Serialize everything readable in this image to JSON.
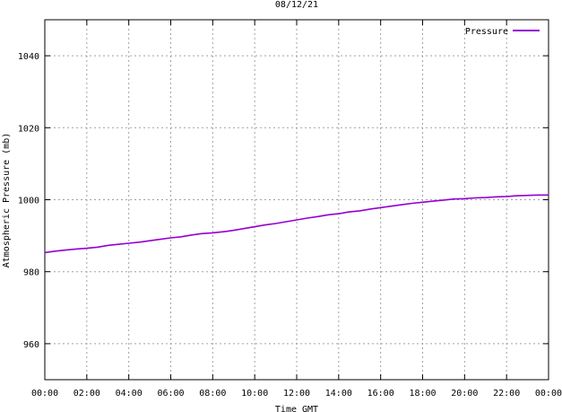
{
  "chart_data": {
    "type": "line",
    "title": "08/12/21",
    "xlabel": "Time GMT",
    "ylabel": "Atmospheric Pressure (mb)",
    "xticks": [
      "00:00",
      "02:00",
      "04:00",
      "06:00",
      "08:00",
      "10:00",
      "12:00",
      "14:00",
      "16:00",
      "18:00",
      "20:00",
      "22:00",
      "00:00"
    ],
    "xlim_hours": [
      0,
      24
    ],
    "yticks": [
      960,
      980,
      1000,
      1020,
      1040
    ],
    "ylim": [
      950,
      1050
    ],
    "grid": true,
    "legend_position": "top-right",
    "series": [
      {
        "name": "Pressure",
        "color": "#9400d3",
        "x_hours": [
          0.0,
          0.5,
          1.0,
          1.5,
          2.0,
          2.5,
          3.0,
          3.5,
          4.0,
          4.5,
          5.0,
          5.5,
          6.0,
          6.5,
          7.0,
          7.5,
          8.0,
          8.5,
          9.0,
          9.5,
          10.0,
          10.5,
          11.0,
          11.5,
          12.0,
          12.5,
          13.0,
          13.5,
          14.0,
          14.5,
          15.0,
          15.5,
          16.0,
          16.5,
          17.0,
          17.5,
          18.0,
          18.5,
          19.0,
          19.5,
          20.0,
          20.5,
          21.0,
          21.5,
          22.0,
          22.5,
          23.0,
          23.5,
          24.0
        ],
        "values": [
          985.3,
          985.7,
          986.0,
          986.3,
          986.5,
          986.8,
          987.3,
          987.6,
          987.9,
          988.2,
          988.6,
          989.0,
          989.4,
          989.7,
          990.2,
          990.6,
          990.8,
          991.1,
          991.5,
          992.0,
          992.5,
          993.0,
          993.4,
          993.9,
          994.4,
          994.9,
          995.3,
          995.8,
          996.1,
          996.6,
          996.9,
          997.4,
          997.8,
          998.2,
          998.6,
          999.0,
          999.3,
          999.6,
          999.9,
          1000.2,
          1000.3,
          1000.5,
          1000.6,
          1000.8,
          1000.9,
          1001.1,
          1001.2,
          1001.3,
          1001.3
        ]
      }
    ]
  }
}
